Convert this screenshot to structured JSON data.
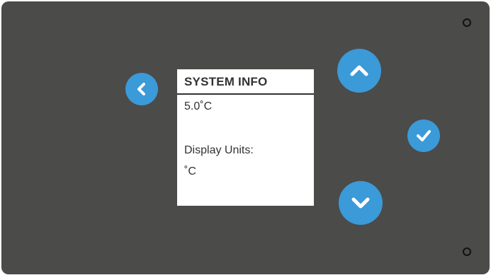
{
  "screen": {
    "title": "SYSTEM INFO",
    "temperature": "5.0˚C",
    "display_units_label": "Display Units:",
    "display_units_value": "˚C"
  },
  "buttons": {
    "back_icon": "chevron-left-icon",
    "up_icon": "chevron-up-icon",
    "confirm_icon": "checkmark-icon",
    "down_icon": "chevron-down-icon"
  },
  "colors": {
    "panel": "#4b4b4a",
    "button": "#3b9ad8",
    "screen": "#ffffff",
    "text": "#333333"
  }
}
